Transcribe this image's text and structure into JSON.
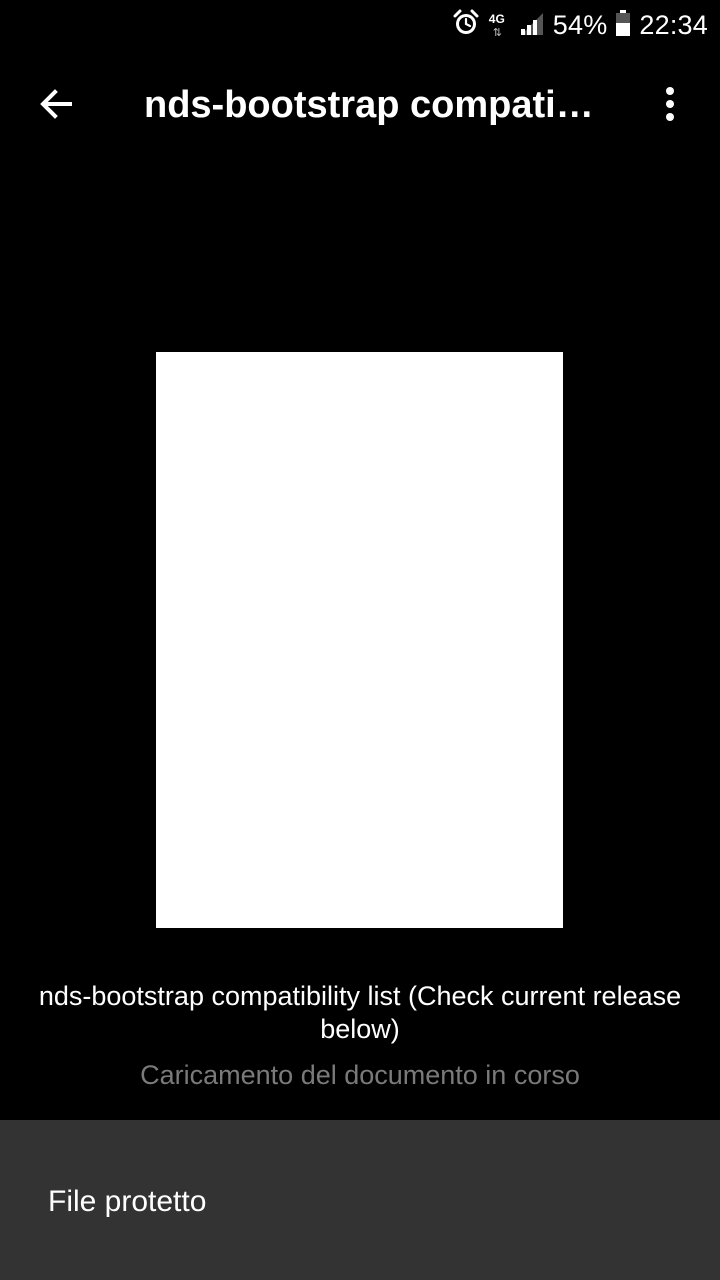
{
  "status_bar": {
    "network_type": "4G",
    "network_arrows": "⇅",
    "battery_percent": "54%",
    "time": "22:34",
    "icons": [
      "alarm-clock-icon",
      "network-4g-icon",
      "signal-strength-icon",
      "battery-icon"
    ]
  },
  "app_bar": {
    "back_icon": "arrow-back-icon",
    "title": "nds-bootstrap compatib...",
    "more_icon": "more-vertical-icon"
  },
  "document": {
    "name": "nds-bootstrap compatibility list (Check current release below)",
    "loading_status": "Caricamento del documento in corso"
  },
  "bottom_panel": {
    "label": "File protetto"
  },
  "colors": {
    "background": "#000000",
    "panel": "#333333",
    "text_primary": "#ffffff",
    "text_secondary": "#7a7a7a"
  }
}
